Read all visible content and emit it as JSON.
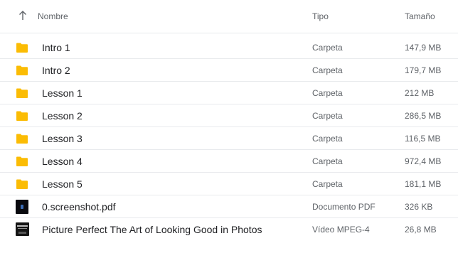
{
  "header": {
    "sort_icon": "arrow-up-icon",
    "name_label": "Nombre",
    "type_label": "Tipo",
    "size_label": "Tamaño"
  },
  "colors": {
    "folder": "#fbbc04",
    "row_divider": "#e8eaed",
    "primary_text": "#202124",
    "secondary_text": "#5f6368"
  },
  "files": [
    {
      "name": "Intro 1",
      "type": "Carpeta",
      "size": "147,9 MB",
      "icon": "folder-icon"
    },
    {
      "name": "Intro 2",
      "type": "Carpeta",
      "size": "179,7 MB",
      "icon": "folder-icon"
    },
    {
      "name": "Lesson 1",
      "type": "Carpeta",
      "size": "212 MB",
      "icon": "folder-icon"
    },
    {
      "name": "Lesson 2",
      "type": "Carpeta",
      "size": "286,5 MB",
      "icon": "folder-icon"
    },
    {
      "name": "Lesson 3",
      "type": "Carpeta",
      "size": "116,5 MB",
      "icon": "folder-icon"
    },
    {
      "name": "Lesson 4",
      "type": "Carpeta",
      "size": "972,4 MB",
      "icon": "folder-icon"
    },
    {
      "name": "Lesson 5",
      "type": "Carpeta",
      "size": "181,1 MB",
      "icon": "folder-icon"
    },
    {
      "name": "0.screenshot.pdf",
      "type": "Documento PDF",
      "size": "326 KB",
      "icon": "pdf-thumbnail-icon"
    },
    {
      "name": "Picture Perfect The Art of Looking Good in Photos",
      "type": "Vídeo MPEG-4",
      "size": "26,8 MB",
      "icon": "video-thumbnail-icon"
    }
  ]
}
